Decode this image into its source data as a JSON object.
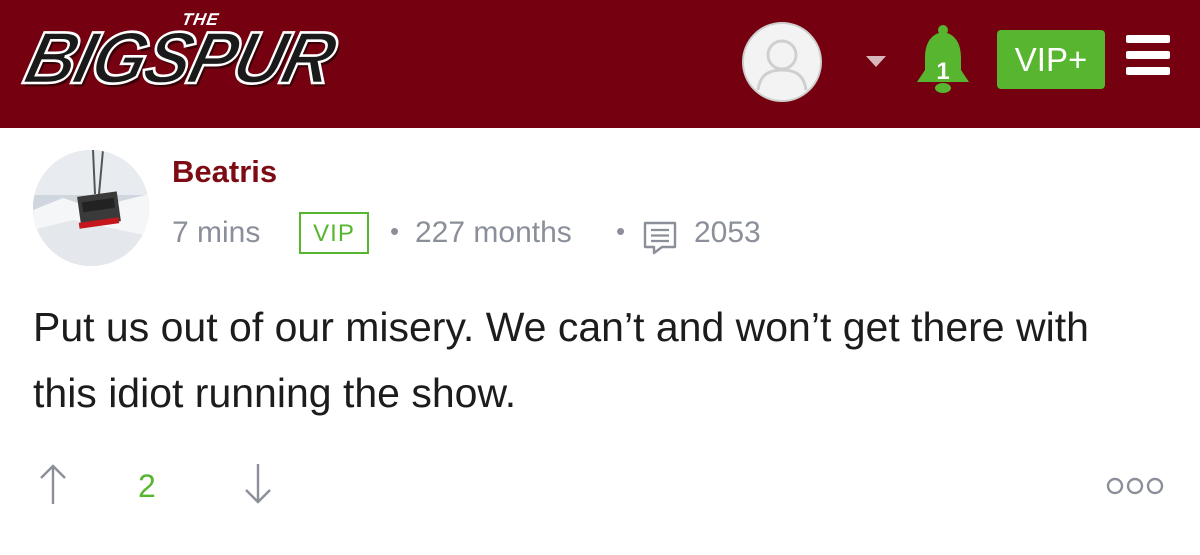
{
  "header": {
    "logo_the": "THE",
    "logo_big": "BIG",
    "logo_spur": "SPUR",
    "notification_count": "1",
    "vip_button_label": "VIP+",
    "colors": {
      "background": "#75000f",
      "accent_green": "#57b52f"
    }
  },
  "post": {
    "username": "Beatris",
    "time": "7 mins",
    "badge": "VIP",
    "separator": "•",
    "membership": "227 months",
    "comment_count": "2053",
    "body": "Put us out of our misery. We can’t and won’t get there with this idiot running the show."
  },
  "actions": {
    "score": "2",
    "icons": [
      "arrow-up-icon",
      "arrow-down-icon",
      "more-icon"
    ]
  }
}
